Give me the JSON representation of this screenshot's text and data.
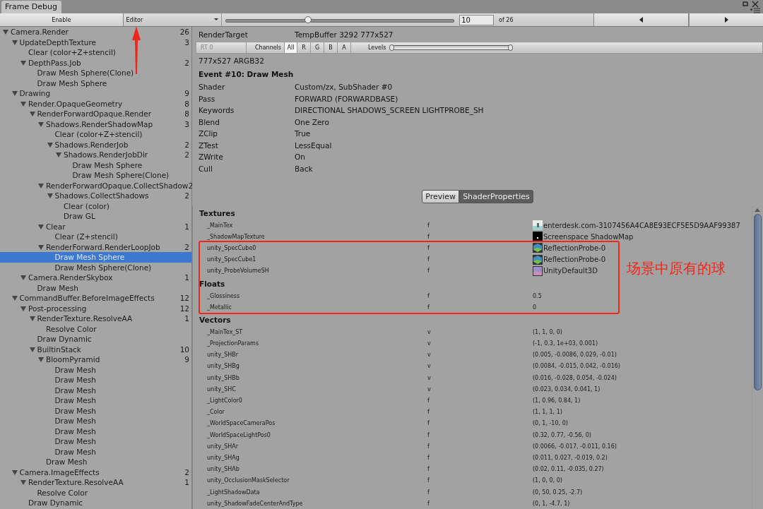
{
  "window": {
    "title": "Frame Debug"
  },
  "toolbar": {
    "enable_label": "Enable",
    "target": "Editor",
    "event_slider": {
      "level": 0.36
    },
    "event_number": "10",
    "event_total": "of 26"
  },
  "tree": [
    {
      "label": "Camera.Render",
      "count": "26",
      "selected": false,
      "expanded": true,
      "children": [
        {
          "label": "UpdateDepthTexture",
          "count": "3",
          "selected": false,
          "expanded": true,
          "children": [
            {
              "label": "Clear (color+Z+stencil)",
              "selected": false
            },
            {
              "label": "DepthPass.Job",
              "count": "2",
              "selected": false,
              "expanded": true,
              "children": [
                {
                  "label": "Draw Mesh Sphere(Clone)",
                  "selected": false
                },
                {
                  "label": "Draw Mesh Sphere",
                  "selected": false
                }
              ]
            }
          ]
        },
        {
          "label": "Drawing",
          "count": "9",
          "selected": false,
          "expanded": true,
          "children": [
            {
              "label": "Render.OpaqueGeometry",
              "count": "8",
              "selected": false,
              "expanded": true,
              "children": [
                {
                  "label": "RenderForwardOpaque.Render",
                  "count": "8",
                  "selected": false,
                  "expanded": true,
                  "children": [
                    {
                      "label": "Shadows.RenderShadowMap",
                      "count": "3",
                      "selected": false,
                      "expanded": true,
                      "children": [
                        {
                          "label": "Clear (color+Z+stencil)",
                          "selected": false
                        },
                        {
                          "label": "Shadows.RenderJob",
                          "count": "2",
                          "selected": false,
                          "expanded": true,
                          "children": [
                            {
                              "label": "Shadows.RenderJobDir",
                              "count": "2",
                              "selected": false,
                              "expanded": true,
                              "children": [
                                {
                                  "label": "Draw Mesh Sphere",
                                  "selected": false
                                },
                                {
                                  "label": "Draw Mesh Sphere(Clone)",
                                  "selected": false
                                }
                              ]
                            }
                          ]
                        }
                      ]
                    },
                    {
                      "label": "RenderForwardOpaque.CollectShadow",
                      "count": "2",
                      "selected": false,
                      "expanded": true,
                      "children": [
                        {
                          "label": "Shadows.CollectShadows",
                          "count": "2",
                          "selected": false,
                          "expanded": true,
                          "children": [
                            {
                              "label": "Clear (color)",
                              "selected": false
                            },
                            {
                              "label": "Draw GL",
                              "selected": false
                            }
                          ]
                        }
                      ]
                    },
                    {
                      "label": "Clear",
                      "count": "1",
                      "selected": false,
                      "expanded": true,
                      "children": [
                        {
                          "label": "Clear (Z+stencil)",
                          "selected": false
                        }
                      ]
                    },
                    {
                      "label": "RenderForward.RenderLoopJob",
                      "count": "2",
                      "selected": false,
                      "expanded": true,
                      "children": [
                        {
                          "label": "Draw Mesh Sphere",
                          "selected": true
                        },
                        {
                          "label": "Draw Mesh Sphere(Clone)",
                          "selected": false
                        }
                      ]
                    }
                  ]
                }
              ]
            },
            {
              "label": "Camera.RenderSkybox",
              "count": "1",
              "selected": false,
              "expanded": true,
              "children": [
                {
                  "label": "Draw Mesh",
                  "selected": false
                }
              ]
            }
          ]
        },
        {
          "label": "CommandBuffer.BeforeImageEffects",
          "count": "12",
          "selected": false,
          "expanded": true,
          "children": [
            {
              "label": "Post-processing",
              "count": "12",
              "selected": false,
              "expanded": true,
              "children": [
                {
                  "label": "RenderTexture.ResolveAA",
                  "count": "1",
                  "selected": false,
                  "expanded": true,
                  "children": [
                    {
                      "label": "Resolve Color",
                      "selected": false
                    }
                  ]
                },
                {
                  "label": "Draw Dynamic",
                  "selected": false
                },
                {
                  "label": "BuiltinStack",
                  "count": "10",
                  "selected": false,
                  "expanded": true,
                  "children": [
                    {
                      "label": "BloomPyramid",
                      "count": "9",
                      "selected": false,
                      "expanded": true,
                      "children": [
                        {
                          "label": "Draw Mesh",
                          "selected": false
                        },
                        {
                          "label": "Draw Mesh",
                          "selected": false
                        },
                        {
                          "label": "Draw Mesh",
                          "selected": false
                        },
                        {
                          "label": "Draw Mesh",
                          "selected": false
                        },
                        {
                          "label": "Draw Mesh",
                          "selected": false
                        },
                        {
                          "label": "Draw Mesh",
                          "selected": false
                        },
                        {
                          "label": "Draw Mesh",
                          "selected": false
                        },
                        {
                          "label": "Draw Mesh",
                          "selected": false
                        },
                        {
                          "label": "Draw Mesh",
                          "selected": false
                        }
                      ]
                    },
                    {
                      "label": "Draw Mesh",
                      "selected": false
                    }
                  ]
                }
              ]
            }
          ]
        },
        {
          "label": "Camera.ImageEffects",
          "count": "2",
          "selected": false,
          "expanded": true,
          "children": [
            {
              "label": "RenderTexture.ResolveAA",
              "count": "1",
              "selected": false,
              "expanded": true,
              "children": [
                {
                  "label": "Resolve Color",
                  "selected": false
                }
              ]
            },
            {
              "label": "Draw Dynamic",
              "selected": false
            }
          ]
        }
      ]
    }
  ],
  "render_target": {
    "label": "RenderTarget",
    "value": "TempBuffer 3292 777x527"
  },
  "channels_bar": {
    "rt": "RT 0",
    "channels_label": "Channels",
    "channels": [
      {
        "label": "All",
        "selected": true
      },
      {
        "label": "R",
        "selected": false
      },
      {
        "label": "G",
        "selected": false
      },
      {
        "label": "B",
        "selected": false
      },
      {
        "label": "A",
        "selected": false
      }
    ],
    "levels": {
      "label": "Levels",
      "level": 1
    }
  },
  "format": "777x527 ARGB32",
  "event_title": "Event #10: Draw Mesh",
  "details": [
    {
      "label": "Shader",
      "value": "Custom/zx, SubShader #0"
    },
    {
      "label": "Pass",
      "value": "FORWARD (FORWARDBASE)"
    },
    {
      "label": "Keywords",
      "value": "DIRECTIONAL SHADOWS_SCREEN LIGHTPROBE_SH"
    },
    {
      "label": "Blend",
      "value": "One Zero"
    },
    {
      "label": "ZClip",
      "value": "True"
    },
    {
      "label": "ZTest",
      "value": "LessEqual"
    },
    {
      "label": "ZWrite",
      "value": "On"
    },
    {
      "label": "Cull",
      "value": "Back"
    }
  ],
  "view_tabs": [
    {
      "label": "Preview",
      "selected": false
    },
    {
      "label": "ShaderProperties",
      "selected": true
    }
  ],
  "sections": [
    {
      "title": "Textures",
      "rows": [
        {
          "name": "_MainTex",
          "type": "f",
          "value": "enterdesk.com-3107456A4CA8E93ECF5E5D9AAF99387",
          "kind": "image"
        },
        {
          "name": "_ShadowMapTexture",
          "type": "f",
          "value": "Screenspace ShadowMap",
          "kind": "shadowmap"
        },
        {
          "name": "unity_SpecCube0",
          "type": "f",
          "value": "ReflectionProbe-0",
          "kind": "probe"
        },
        {
          "name": "unity_SpecCube1",
          "type": "f",
          "value": "ReflectionProbe-0",
          "kind": "probe"
        },
        {
          "name": "unity_ProbeVolumeSH",
          "type": "f",
          "value": "UnityDefault3D",
          "kind": "default3d"
        }
      ]
    },
    {
      "title": "Floats",
      "rows": [
        {
          "name": "_Glossiness",
          "type": "f",
          "value": "0.5"
        },
        {
          "name": "_Metallic",
          "type": "f",
          "value": "0"
        }
      ]
    },
    {
      "title": "Vectors",
      "rows": [
        {
          "name": "_MainTex_ST",
          "type": "v",
          "value": "(1, 1, 0, 0)"
        },
        {
          "name": "_ProjectionParams",
          "type": "v",
          "value": "(-1, 0.3, 1e+03, 0.001)"
        },
        {
          "name": "unity_SHBr",
          "type": "v",
          "value": "(0.005, -0.0086, 0.029, -0.01)"
        },
        {
          "name": "unity_SHBg",
          "type": "v",
          "value": "(0.0084, -0.015, 0.042, -0.016)"
        },
        {
          "name": "unity_SHBb",
          "type": "v",
          "value": "(0.016, -0.028, 0.054, -0.024)"
        },
        {
          "name": "unity_SHC",
          "type": "v",
          "value": "(0.023, 0.034, 0.041, 1)"
        },
        {
          "name": "_LightColor0",
          "type": "f",
          "value": "(1, 0.96, 0.84, 1)"
        },
        {
          "name": "_Color",
          "type": "f",
          "value": "(1, 1, 1, 1)"
        },
        {
          "name": "_WorldSpaceCameraPos",
          "type": "f",
          "value": "(0, 1, -10, 0)"
        },
        {
          "name": "_WorldSpaceLightPos0",
          "type": "f",
          "value": "(0.32, 0.77, -0.56, 0)"
        },
        {
          "name": "unity_SHAr",
          "type": "f",
          "value": "(0.0066, -0.017, -0.011, 0.16)"
        },
        {
          "name": "unity_SHAg",
          "type": "f",
          "value": "(0.011, 0.027, -0.019, 0.2)"
        },
        {
          "name": "unity_SHAb",
          "type": "f",
          "value": "(0.02, 0.11, -0.035, 0.27)"
        },
        {
          "name": "unity_OcclusionMaskSelector",
          "type": "f",
          "value": "(1, 0, 0, 0)"
        },
        {
          "name": "_LightShadowData",
          "type": "f",
          "value": "(0, 50, 0.25, -2.7)"
        },
        {
          "name": "unity_ShadowFadeCenterAndType",
          "type": "f",
          "value": "(0, 1, -4.7, 1)"
        }
      ]
    }
  ],
  "annotation": {
    "text": "场景中原有的球"
  }
}
